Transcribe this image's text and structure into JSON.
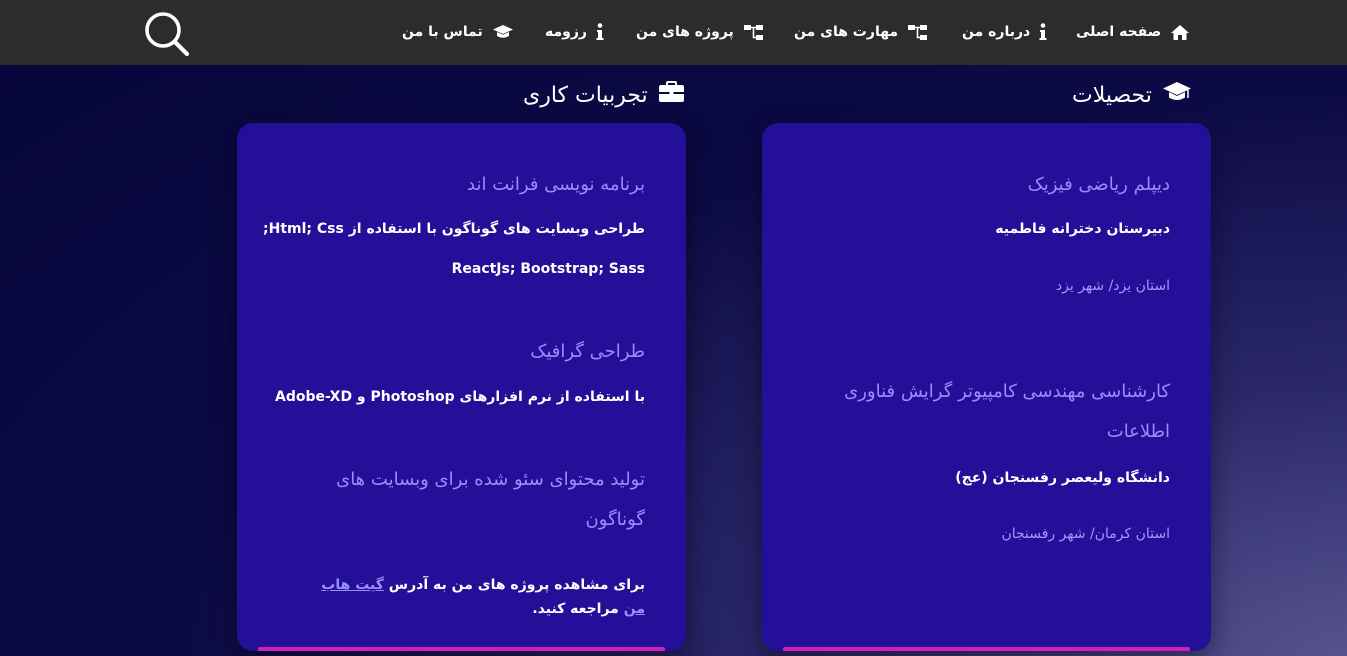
{
  "nav": {
    "items": [
      {
        "id": "home",
        "label": "صفحه اصلی",
        "icon": "home-icon"
      },
      {
        "id": "about",
        "label": "درباره من",
        "icon": "info-icon"
      },
      {
        "id": "skills",
        "label": "مهارت های من",
        "icon": "sitemap-icon"
      },
      {
        "id": "projects",
        "label": "پروژه های من",
        "icon": "sitemap-icon"
      },
      {
        "id": "resume",
        "label": "رزومه",
        "icon": "info-icon"
      },
      {
        "id": "contact",
        "label": "تماس با من",
        "icon": "graduation-cap-icon"
      }
    ],
    "search_icon": "search-icon"
  },
  "education": {
    "title": "تحصیلات",
    "icon": "graduation-cap-icon",
    "entries": [
      {
        "degree": "دیپلم ریاضی فیزیک",
        "school": "دبیرستان دخترانه فاطمیه",
        "location": "استان یزد/ شهر یزد"
      },
      {
        "degree": "کارشناسی مهندسی کامپیوتر گرایش فناوری اطلاعات",
        "school": "دانشگاه ولیعصر رفسنجان (عج)",
        "location": "استان کرمان/ شهر رفسنجان"
      }
    ]
  },
  "experience": {
    "title": "تجربیات کاری",
    "icon": "briefcase-icon",
    "entries": [
      {
        "title": "برنامه نویسی فرانت اند",
        "line1": "طراحی وبسایت های گوناگون با استفاده از Html; Css;",
        "line2": "ReactJs; Bootstrap; Sass"
      },
      {
        "title": "طراحی گرافیک",
        "line1": "با استفاده از نرم افزارهای Photoshop و Adobe-XD"
      },
      {
        "title": "تولید محتوای سئو شده برای وبسایت های گوناگون",
        "text_before": "برای مشاهده پروژه های من به آدرس",
        "link": "گیت هاب من",
        "text_after": "مراجعه کنید."
      }
    ]
  },
  "colors": {
    "navbar": "#2b2c2e",
    "card": "#230f98",
    "card_bar": "#d41dbf",
    "heading": "#9c8dff"
  }
}
